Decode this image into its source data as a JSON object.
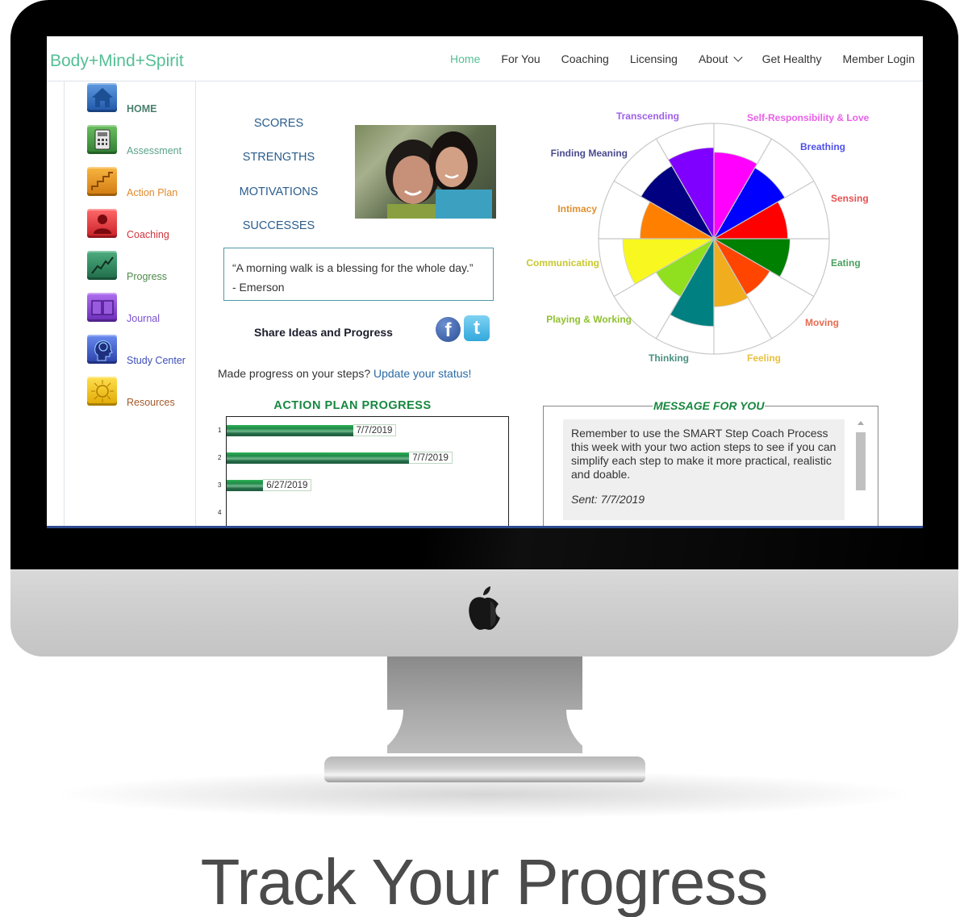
{
  "site": {
    "brand": "Body+Mind+Spirit",
    "nav": [
      {
        "label": "Home",
        "active": true
      },
      {
        "label": "For You"
      },
      {
        "label": "Coaching"
      },
      {
        "label": "Licensing"
      },
      {
        "label": "About",
        "has_dropdown": true
      },
      {
        "label": "Get Healthy"
      },
      {
        "label": "Member Login"
      }
    ]
  },
  "sidebar": {
    "items": [
      {
        "label": "HOME",
        "icon": "house-icon",
        "color": "#4a7f6e",
        "icon_bg": "#2f6bb5"
      },
      {
        "label": "Assessment",
        "icon": "calculator-icon",
        "color": "#5aa28b",
        "icon_bg": "#3f9440"
      },
      {
        "label": "Action Plan",
        "icon": "stairs-icon",
        "color": "#e08a2c",
        "icon_bg": "#e89a25"
      },
      {
        "label": "Coaching",
        "icon": "person-icon",
        "color": "#d0333c",
        "icon_bg": "#e0383f"
      },
      {
        "label": "Progress",
        "icon": "trend-chart-icon",
        "color": "#4f8a4a",
        "icon_bg": "#2e8a5c"
      },
      {
        "label": "Journal",
        "icon": "book-icon",
        "color": "#7b4fd0",
        "icon_bg": "#8e45d6"
      },
      {
        "label": "Study Center",
        "icon": "head-brain-icon",
        "color": "#3d4fb8",
        "icon_bg": "#3b54c8"
      },
      {
        "label": "Resources",
        "icon": "sun-icon",
        "color": "#a35a2a",
        "icon_bg": "#f0c21a"
      }
    ]
  },
  "main": {
    "links": [
      "SCORES",
      "STRENGTHS",
      "MOTIVATIONS",
      "SUCCESSES"
    ],
    "photo_alt": "Mother and daughter smiling",
    "quote": {
      "text": "“A morning walk is a blessing for the whole day.”",
      "author": "- Emerson"
    },
    "share_label": "Share Ideas and Progress",
    "social": [
      "facebook",
      "twitter"
    ],
    "progress_prompt": "Made progress on your steps?",
    "progress_link": "Update your status!"
  },
  "message": {
    "title": "MESSAGE FOR YOU",
    "body": "Remember to use the SMART Step Coach Process this week with your two action steps to see if you can simplify each step to make it more practical, realistic and doable.",
    "sent": "Sent: 7/7/2019"
  },
  "caption": "Track Your Progress",
  "chart_data": [
    {
      "type": "bar",
      "orientation": "horizontal",
      "title": "ACTION PLAN PROGRESS",
      "categories": [
        "1",
        "2",
        "3",
        "4"
      ],
      "values": [
        0.45,
        0.65,
        0.13,
        0
      ],
      "value_unit": "fraction of step completed (estimated)",
      "data_labels": [
        "7/7/2019",
        "7/7/2019",
        "6/27/2019",
        ""
      ],
      "xlim": [
        0,
        1
      ],
      "color": "#1f8a48"
    },
    {
      "type": "polar-area",
      "title": "",
      "categories": [
        "Self-Responsibility & Love",
        "Breathing",
        "Sensing",
        "Eating",
        "Moving",
        "Feeling",
        "Thinking",
        "Playing & Working",
        "Communicating",
        "Intimacy",
        "Finding Meaning",
        "Transcending"
      ],
      "values": [
        0.75,
        0.71,
        0.64,
        0.66,
        0.56,
        0.59,
        0.76,
        0.58,
        0.79,
        0.64,
        0.73,
        0.79
      ],
      "rmax": 1,
      "colors": [
        "#ff00ff",
        "#0000ff",
        "#ff0000",
        "#008000",
        "#ff4500",
        "#f0ad1e",
        "#008080",
        "#90e020",
        "#f8f820",
        "#ff8000",
        "#000080",
        "#8000ff"
      ],
      "label_colors": [
        "#e860e8",
        "#5050e8",
        "#e85050",
        "#4aa060",
        "#e86a50",
        "#e8c040",
        "#4a9080",
        "#90c030",
        "#c8c830",
        "#e09030",
        "#4a4a90",
        "#a060e8"
      ],
      "grid": true,
      "start": "top",
      "direction": "clockwise"
    }
  ]
}
